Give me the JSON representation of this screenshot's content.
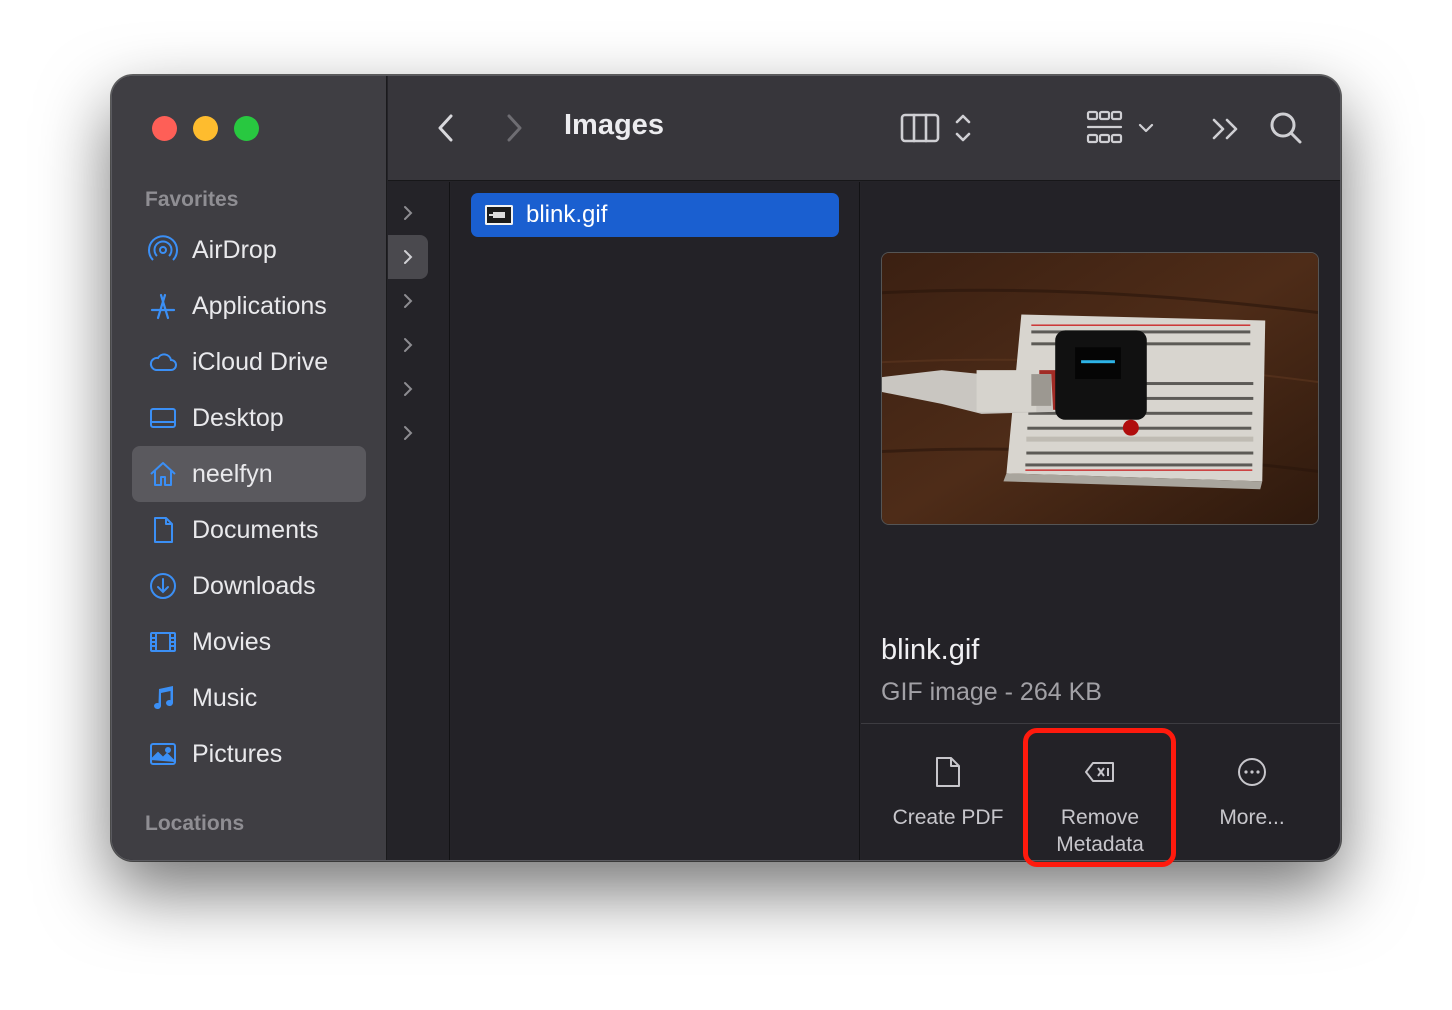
{
  "window": {
    "title": "Images"
  },
  "sidebar": {
    "favorites_title": "Favorites",
    "locations_title": "Locations",
    "items": [
      {
        "label": "AirDrop",
        "icon": "airdrop-icon"
      },
      {
        "label": "Applications",
        "icon": "applications-icon"
      },
      {
        "label": "iCloud Drive",
        "icon": "cloud-icon"
      },
      {
        "label": "Desktop",
        "icon": "desktop-icon"
      },
      {
        "label": "neelfyn",
        "icon": "home-icon",
        "selected": true
      },
      {
        "label": "Documents",
        "icon": "document-icon"
      },
      {
        "label": "Downloads",
        "icon": "download-icon"
      },
      {
        "label": "Movies",
        "icon": "film-icon"
      },
      {
        "label": "Music",
        "icon": "music-note-icon"
      },
      {
        "label": "Pictures",
        "icon": "photo-icon"
      }
    ]
  },
  "files": [
    {
      "name": "blink.gif",
      "selected": true
    }
  ],
  "preview": {
    "name": "blink.gif",
    "kind": "GIF image - 264 KB",
    "actions": [
      {
        "label": "Create PDF",
        "icon": "document-icon"
      },
      {
        "label": "Remove Metadata",
        "icon": "tag-remove-icon"
      },
      {
        "label": "More...",
        "icon": "ellipsis-circle-icon"
      }
    ]
  },
  "colors": {
    "accent": "#1a5fd0",
    "annotation": "#ff1a0d",
    "sidebar_icon": "#3b8ff5"
  }
}
